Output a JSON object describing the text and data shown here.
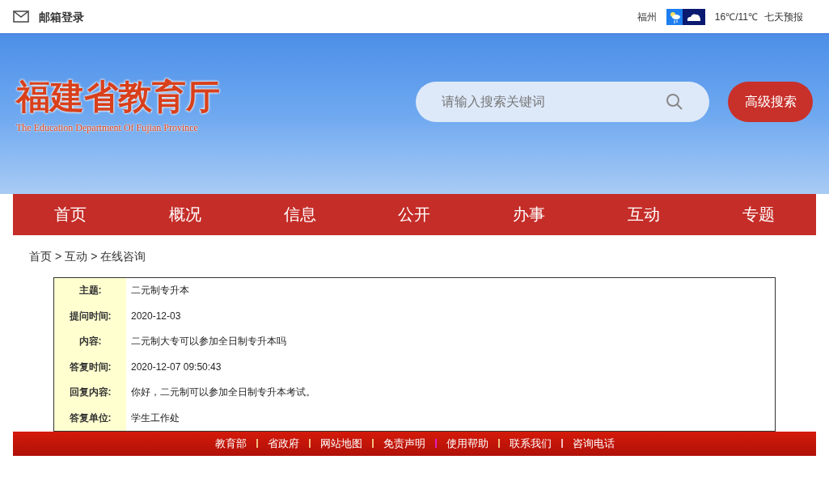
{
  "top_bar": {
    "mail_login": "邮箱登录",
    "city": "福州",
    "temperature": "16℃/11℃",
    "forecast_link": "七天预报"
  },
  "header": {
    "logo_title": "福建省教育厅",
    "logo_subtitle": "The Education Department Of Fujian Province",
    "search": {
      "placeholder": "请输入搜索关键词"
    },
    "advanced_search": "高级搜索"
  },
  "nav": [
    {
      "label": "首页"
    },
    {
      "label": "概况"
    },
    {
      "label": "信息"
    },
    {
      "label": "公开"
    },
    {
      "label": "办事"
    },
    {
      "label": "互动"
    },
    {
      "label": "专题"
    }
  ],
  "breadcrumb": {
    "items": [
      "首页",
      "互动",
      "在线咨询"
    ],
    "separators": [
      ">",
      ">"
    ]
  },
  "details": [
    {
      "label": "主题:",
      "value": "二元制专升本"
    },
    {
      "label": "提问时间:",
      "value": "2020-12-03"
    },
    {
      "label": "内容:",
      "value": "二元制大专可以参加全日制专升本吗"
    },
    {
      "label": "答复时间:",
      "value": "2020-12-07 09:50:43"
    },
    {
      "label": "回复内容:",
      "value": "你好，二元制可以参加全日制专升本考试。"
    },
    {
      "label": "答复单位:",
      "value": "学生工作处"
    }
  ],
  "footer_links": [
    {
      "label": "教育部",
      "color": "#f0c080"
    },
    {
      "label": "省政府",
      "color": "#f0c080"
    },
    {
      "label": "网站地图",
      "color": "#f0c080"
    },
    {
      "label": "免责声明",
      "color": "#e020c0"
    },
    {
      "label": "使用帮助",
      "color": "#f0c080"
    },
    {
      "label": "联系我们",
      "color": "#f0c0c0"
    },
    {
      "label": "咨询电话"
    }
  ]
}
